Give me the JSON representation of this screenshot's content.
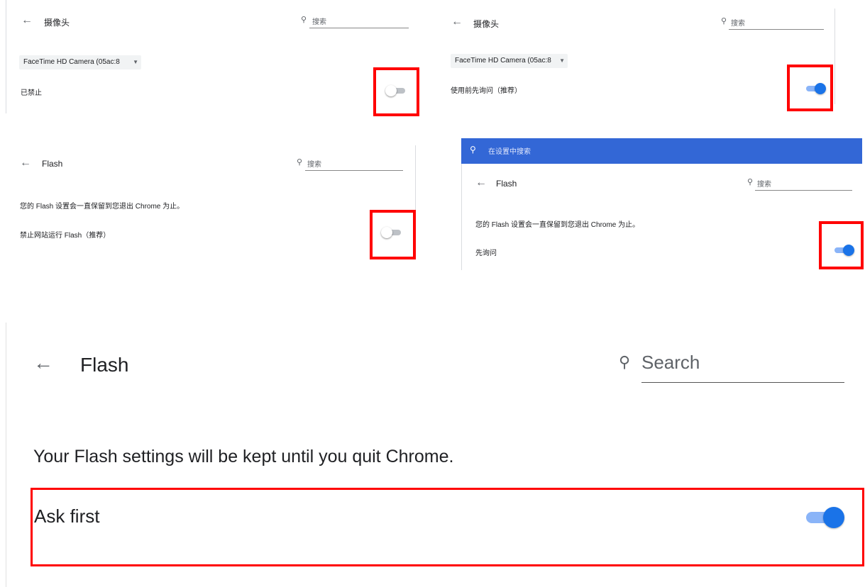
{
  "panels": {
    "camera_blocked": {
      "title": "摄像头",
      "search_placeholder": "搜索",
      "device": "FaceTime HD Camera (05ac:8",
      "setting_label": "已禁止",
      "toggle_state": "off"
    },
    "camera_ask": {
      "title": "摄像头",
      "search_placeholder": "搜索",
      "device": "FaceTime HD Camera (05ac:8",
      "setting_label": "使用前先询问（推荐）",
      "toggle_state": "on"
    },
    "flash_blocked": {
      "title": "Flash",
      "search_placeholder": "搜索",
      "note": "您的 Flash 设置会一直保留到您退出 Chrome 为止。",
      "setting_label": "禁止网站运行 Flash（推荐）",
      "toggle_state": "off"
    },
    "flash_ask": {
      "top_search_placeholder": "在设置中搜索",
      "title": "Flash",
      "search_placeholder": "搜索",
      "note": "您的 Flash 设置会一直保留到您退出 Chrome 为止。",
      "setting_label": "先询问",
      "toggle_state": "on"
    },
    "flash_english": {
      "title": "Flash",
      "search_placeholder": "Search",
      "note": "Your Flash settings will be kept until you quit Chrome.",
      "setting_label": "Ask first",
      "toggle_state": "on"
    }
  },
  "colors": {
    "highlight": "#ff0000",
    "toggle_on_track": "#8ab4f8",
    "toggle_on_knob": "#1a73e8",
    "toggle_off_track": "#bdc1c6",
    "header_bar": "#3367d6"
  },
  "icons": {
    "back": "arrow-left-icon",
    "search": "search-icon",
    "dropdown": "caret-down-icon"
  }
}
